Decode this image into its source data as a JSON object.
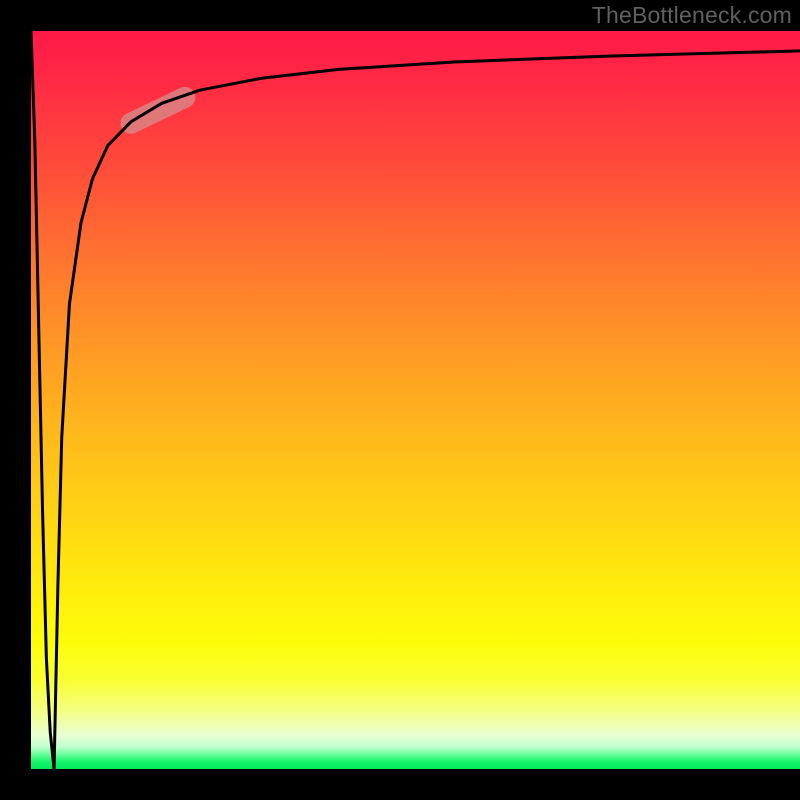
{
  "watermark": "TheBottleneck.com",
  "chart_data": {
    "type": "line",
    "title": "",
    "xlabel": "",
    "ylabel": "",
    "xlim": [
      0,
      100
    ],
    "ylim": [
      0,
      100
    ],
    "grid": false,
    "gradient_stops": [
      {
        "t": 0.0,
        "color": "#ff1946"
      },
      {
        "t": 0.06,
        "color": "#ff2845"
      },
      {
        "t": 0.18,
        "color": "#ff4a3a"
      },
      {
        "t": 0.3,
        "color": "#ff7130"
      },
      {
        "t": 0.42,
        "color": "#ff9626"
      },
      {
        "t": 0.54,
        "color": "#ffb71c"
      },
      {
        "t": 0.66,
        "color": "#ffd513"
      },
      {
        "t": 0.76,
        "color": "#ffee0b"
      },
      {
        "t": 0.83,
        "color": "#fdfd0b"
      },
      {
        "t": 0.88,
        "color": "#f9ff32"
      },
      {
        "t": 0.92,
        "color": "#f4ff82"
      },
      {
        "t": 0.955,
        "color": "#e8ffd4"
      },
      {
        "t": 0.97,
        "color": "#c0ffd0"
      },
      {
        "t": 0.98,
        "color": "#6aff9b"
      },
      {
        "t": 0.99,
        "color": "#17f56b"
      },
      {
        "t": 1.0,
        "color": "#00e95c"
      }
    ],
    "series": [
      {
        "name": "curve-down",
        "x": [
          0.0,
          0.5,
          1.0,
          1.5,
          2.0,
          2.5,
          3.0
        ],
        "y": [
          100,
          85,
          60,
          35,
          15,
          5,
          0
        ]
      },
      {
        "name": "curve-up",
        "x": [
          3.0,
          3.5,
          4.0,
          5.0,
          6.5,
          8.0,
          10.0,
          13.0,
          17.0,
          22.0,
          30.0,
          40.0,
          55.0,
          75.0,
          100.0
        ],
        "y": [
          0,
          25,
          45,
          63,
          74,
          80,
          84.5,
          87.7,
          90.2,
          92.0,
          93.6,
          94.8,
          95.8,
          96.6,
          97.3
        ]
      }
    ],
    "highlight_segment": {
      "x_range": [
        13.0,
        20.0
      ],
      "y_range": [
        87.5,
        91.0
      ],
      "color": "#d88a8a",
      "opacity": 0.78
    }
  }
}
